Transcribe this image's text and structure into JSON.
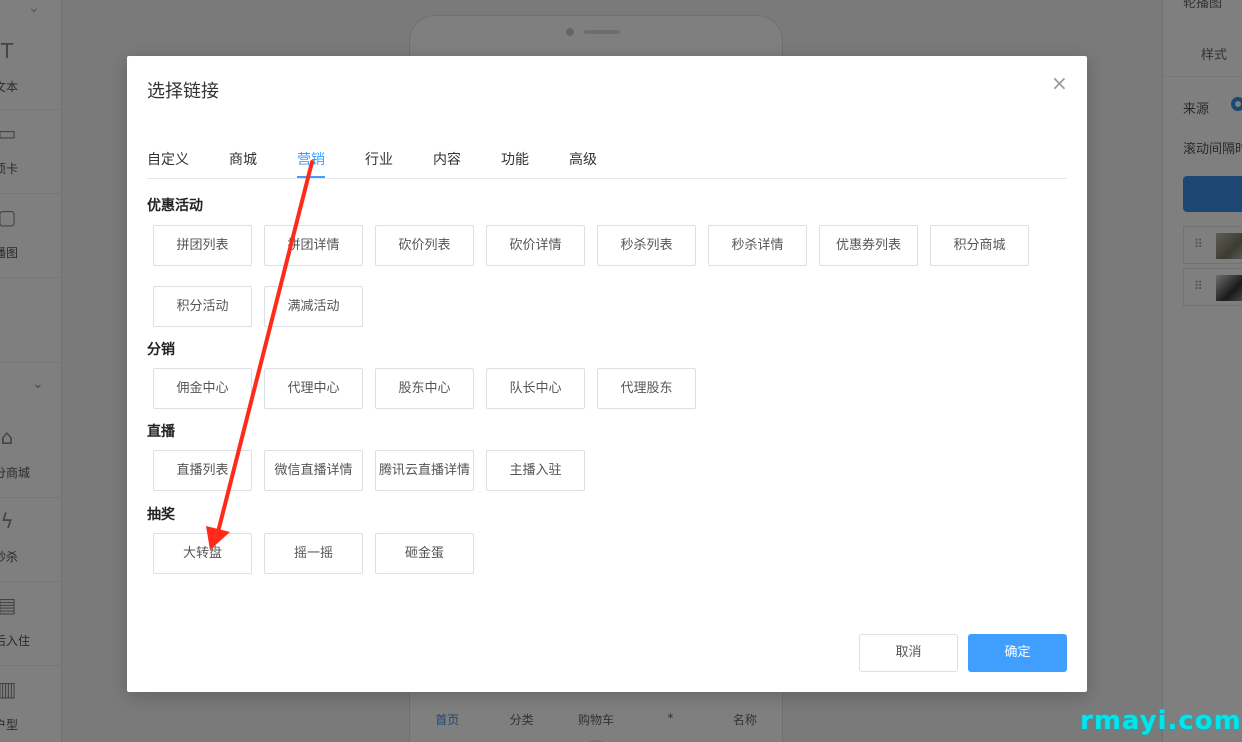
{
  "left_panel": {
    "items": [
      {
        "icon": "text-icon",
        "glyph": "T",
        "label": "文本"
      },
      {
        "icon": "tab-icon",
        "glyph": "▭",
        "label": "项卡"
      },
      {
        "icon": "carousel-icon",
        "glyph": "▢",
        "label": "播图"
      },
      {
        "icon": "store-icon",
        "glyph": "⌂",
        "label": "分商城"
      },
      {
        "icon": "flash-icon",
        "glyph": "ϟ",
        "label": "秒杀"
      },
      {
        "icon": "join-icon",
        "glyph": "▤",
        "label": "后入住"
      },
      {
        "icon": "layout-icon",
        "glyph": "▥",
        "label": "户型"
      }
    ]
  },
  "phone": {
    "nav": [
      "首页",
      "分类",
      "购物车",
      "*",
      "名称"
    ]
  },
  "right_panel": {
    "top_label": "轮播图",
    "style_label": "样式",
    "source_label": "来源",
    "interval_label": "滚动间隔时"
  },
  "modal": {
    "title": "选择链接",
    "close_glyph": "×",
    "tabs": [
      "自定义",
      "商城",
      "营销",
      "行业",
      "内容",
      "功能",
      "高级"
    ],
    "active_tab": "营销",
    "sections": [
      {
        "title": "优惠活动",
        "items": [
          "拼团列表",
          "拼团详情",
          "砍价列表",
          "砍价详情",
          "秒杀列表",
          "秒杀详情",
          "优惠券列表",
          "积分商城",
          "积分活动",
          "满减活动"
        ]
      },
      {
        "title": "分销",
        "items": [
          "佣金中心",
          "代理中心",
          "股东中心",
          "队长中心",
          "代理股东"
        ]
      },
      {
        "title": "直播",
        "items": [
          "直播列表",
          "微信直播详情",
          "腾讯云直播详情",
          "主播入驻"
        ]
      },
      {
        "title": "抽奖",
        "items": [
          "大转盘",
          "摇一摇",
          "砸金蛋"
        ]
      }
    ],
    "cancel_label": "取消",
    "ok_label": "确定"
  },
  "annotation": {
    "color": "#ff2a1a"
  },
  "watermark": "rmayi.com",
  "colors": {
    "primary": "#409eff",
    "overlay": "rgba(0,0,0,0.5)"
  }
}
